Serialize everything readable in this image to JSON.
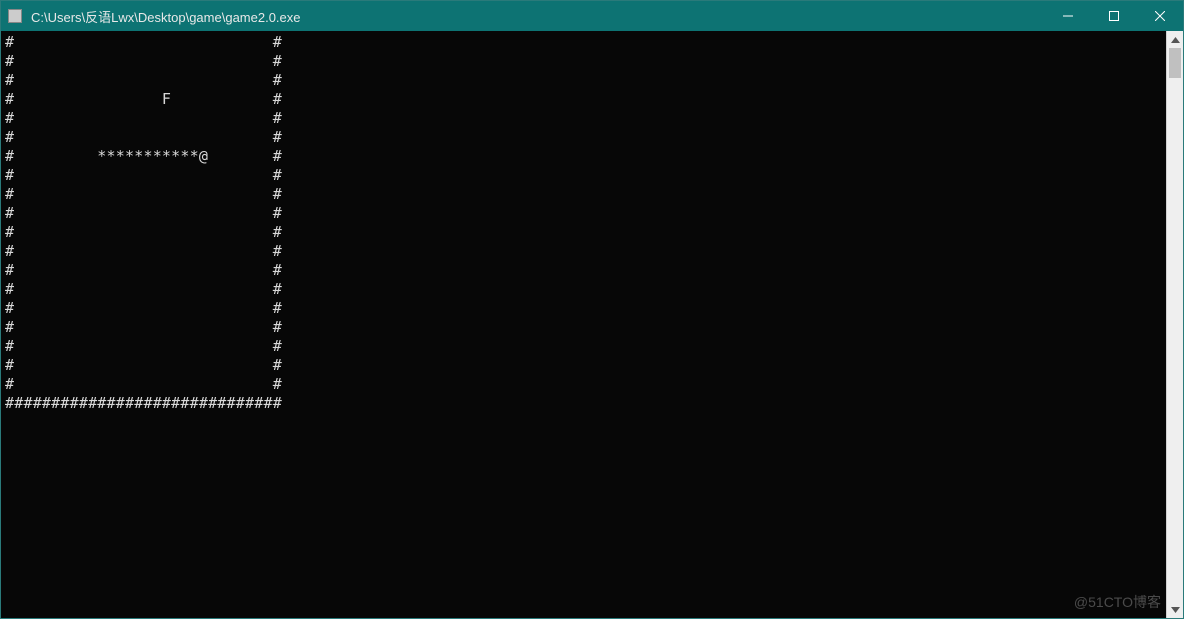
{
  "window": {
    "title": "C:\\Users\\反语Lwx\\Desktop\\game\\game2.0.exe"
  },
  "game": {
    "board_width": 30,
    "board_height": 20,
    "wall_char": "#",
    "food_char": "F",
    "snake_body_char": "*",
    "snake_head_char": "@",
    "food_pos": {
      "row": 3,
      "col": 17
    },
    "snake": {
      "head": {
        "row": 6,
        "col": 21
      },
      "body_cols": [
        10,
        11,
        12,
        13,
        14,
        15,
        16,
        17,
        18,
        19,
        20
      ],
      "body_row": 6
    },
    "rows": [
      "#                            #",
      "#                            #",
      "#                            #",
      "#                F           #",
      "#                            #",
      "#                            #",
      "#         ***********@       #",
      "#                            #",
      "#                            #",
      "#                            #",
      "#                            #",
      "#                            #",
      "#                            #",
      "#                            #",
      "#                            #",
      "#                            #",
      "#                            #",
      "#                            #",
      "#                            #",
      "##############################"
    ]
  },
  "watermark": "@51CTO博客"
}
